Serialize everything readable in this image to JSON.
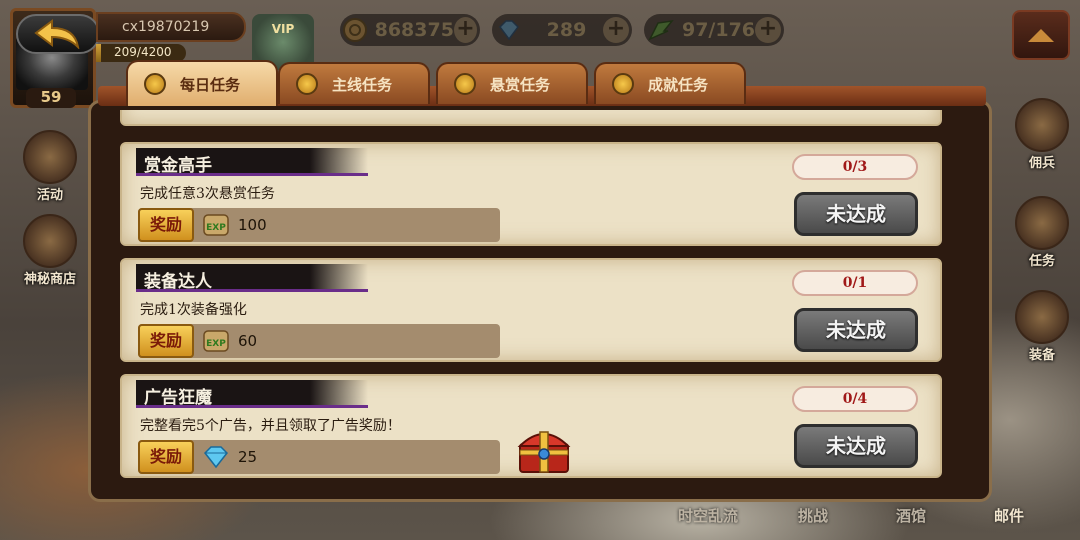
{
  "player": {
    "name": "cx19870219",
    "exp_text": "209/4200",
    "exp_fraction": 0.05,
    "level": "59"
  },
  "resources": {
    "coins": "868375",
    "diamonds": "289",
    "stamina": "97/176"
  },
  "tabs": [
    {
      "label": "每日任务",
      "active": true
    },
    {
      "label": "主线任务",
      "active": false
    },
    {
      "label": "悬赏任务",
      "active": false
    },
    {
      "label": "成就任务",
      "active": false
    }
  ],
  "left_menu": [
    {
      "label": "活动",
      "icon": "treasure-chest-icon"
    },
    {
      "label": "神秘商店",
      "icon": "shop-icon"
    }
  ],
  "right_menu": [
    {
      "label": "佣兵",
      "icon": "mercenary-icon"
    },
    {
      "label": "任务",
      "icon": "quest-scroll-icon"
    },
    {
      "label": "装备",
      "icon": "equipment-icon"
    }
  ],
  "bottom_menu": [
    {
      "label": "时空乱流"
    },
    {
      "label": "挑战"
    },
    {
      "label": "酒馆"
    },
    {
      "label": "邮件"
    }
  ],
  "tasks": [
    {
      "title": "赏金高手",
      "description": "完成任意3次悬赏任务",
      "reward_label": "奖励",
      "reward_icon": "exp-scroll-icon",
      "reward_amount": "100",
      "progress": "0/3",
      "status": "未达成"
    },
    {
      "title": "装备达人",
      "description": "完成1次装备强化",
      "reward_label": "奖励",
      "reward_icon": "exp-scroll-icon",
      "reward_amount": "60",
      "progress": "0/1",
      "status": "未达成"
    },
    {
      "title": "广告狂魔",
      "description": "完整看完5个广告，并且领取了广告奖励！",
      "reward_label": "奖励",
      "reward_icon": "diamond-icon",
      "reward_amount": "25",
      "progress": "0/4",
      "status": "未达成",
      "extra_icon": "treasure-chest-icon"
    }
  ],
  "colors": {
    "panel_bg": "#2c1a10",
    "card_bg": "#ece1c6",
    "reward_button": "#f8d05a",
    "progress_text": "#a01818",
    "status_button": "#5a5a5a"
  }
}
